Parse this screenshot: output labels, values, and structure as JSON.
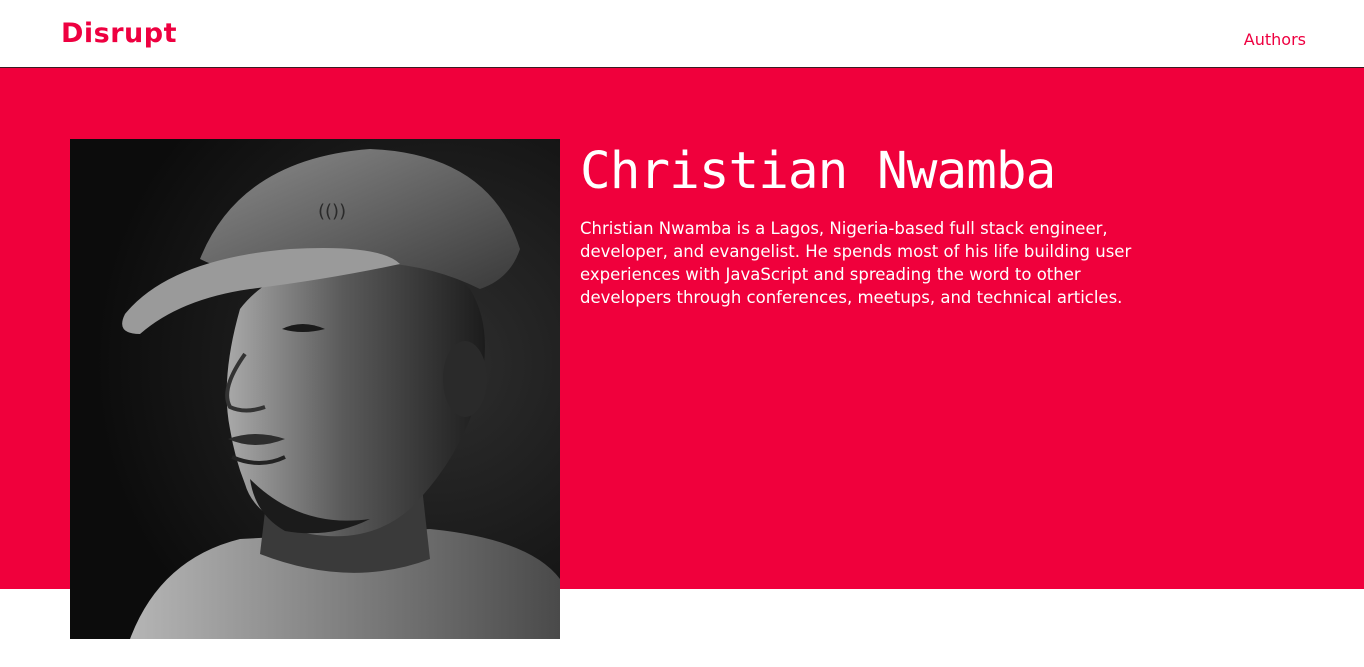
{
  "header": {
    "logo_text": "Disrupt",
    "nav": [
      {
        "label": "Authors"
      }
    ]
  },
  "author": {
    "name": "Christian Nwamba",
    "bio": "Christian Nwamba is a Lagos, Nigeria-based full stack engineer, developer, and evangelist. He spends most of his life building user experiences with JavaScript and spreading the word to other developers through conferences, meetups, and technical articles.",
    "photo_description": "black-and-white portrait of a man wearing a baseball cap"
  },
  "colors": {
    "brand": "#f0003c",
    "header_bg": "#ffffff",
    "text_on_brand": "#ffffff"
  }
}
